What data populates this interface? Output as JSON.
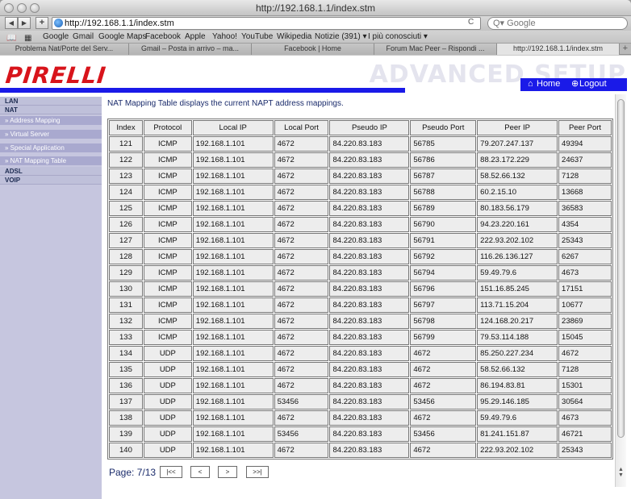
{
  "window": {
    "title": "http://192.168.1.1/index.stm"
  },
  "toolbar": {
    "back": "◀",
    "forward": "▶",
    "add": "+",
    "url": "http://192.168.1.1/index.stm",
    "reload": "C",
    "search_placeholder": "Q▾ Google"
  },
  "bookmarks": {
    "book_icon": "book-icon",
    "grid_icon": "grid-icon",
    "items": [
      "Google",
      "Gmail",
      "Google Maps",
      "Facebook",
      "Apple",
      "Yahoo!",
      "YouTube",
      "Wikipedia",
      "Notizie (391) ▾",
      "I più conosciuti ▾"
    ]
  },
  "tabs": [
    "Problema Nat/Porte del Serv...",
    "Gmail – Posta in arrivo – ma...",
    "Facebook | Home",
    "Forum Mac Peer – Rispondi ...",
    "http://192.168.1.1/index.stm"
  ],
  "tab_plus": "+",
  "header": {
    "logo": "PIRELLI",
    "advanced_setup": "ADVANCED SETUP",
    "home": "Home",
    "logout": "Logout"
  },
  "sidebar": {
    "lan": "LAN",
    "nat": "NAT",
    "address_mapping": "» Address Mapping",
    "virtual_server": "» Virtual Server",
    "special_application": "» Special Application",
    "nat_mapping_table": "» NAT Mapping Table",
    "adsl": "ADSL",
    "voip": "VOIP"
  },
  "main": {
    "description": "NAT Mapping Table displays the current NAPT address mappings.",
    "columns": [
      "Index",
      "Protocol",
      "Local IP",
      "Local Port",
      "Pseudo IP",
      "Pseudo Port",
      "Peer IP",
      "Peer Port"
    ],
    "rows": [
      [
        "121",
        "ICMP",
        "192.168.1.101",
        "4672",
        "84.220.83.183",
        "56785",
        "79.207.247.137",
        "49394"
      ],
      [
        "122",
        "ICMP",
        "192.168.1.101",
        "4672",
        "84.220.83.183",
        "56786",
        "88.23.172.229",
        "24637"
      ],
      [
        "123",
        "ICMP",
        "192.168.1.101",
        "4672",
        "84.220.83.183",
        "56787",
        "58.52.66.132",
        "7128"
      ],
      [
        "124",
        "ICMP",
        "192.168.1.101",
        "4672",
        "84.220.83.183",
        "56788",
        "60.2.15.10",
        "13668"
      ],
      [
        "125",
        "ICMP",
        "192.168.1.101",
        "4672",
        "84.220.83.183",
        "56789",
        "80.183.56.179",
        "36583"
      ],
      [
        "126",
        "ICMP",
        "192.168.1.101",
        "4672",
        "84.220.83.183",
        "56790",
        "94.23.220.161",
        "4354"
      ],
      [
        "127",
        "ICMP",
        "192.168.1.101",
        "4672",
        "84.220.83.183",
        "56791",
        "222.93.202.102",
        "25343"
      ],
      [
        "128",
        "ICMP",
        "192.168.1.101",
        "4672",
        "84.220.83.183",
        "56792",
        "116.26.136.127",
        "6267"
      ],
      [
        "129",
        "ICMP",
        "192.168.1.101",
        "4672",
        "84.220.83.183",
        "56794",
        "59.49.79.6",
        "4673"
      ],
      [
        "130",
        "ICMP",
        "192.168.1.101",
        "4672",
        "84.220.83.183",
        "56796",
        "151.16.85.245",
        "17151"
      ],
      [
        "131",
        "ICMP",
        "192.168.1.101",
        "4672",
        "84.220.83.183",
        "56797",
        "113.71.15.204",
        "10677"
      ],
      [
        "132",
        "ICMP",
        "192.168.1.101",
        "4672",
        "84.220.83.183",
        "56798",
        "124.168.20.217",
        "23869"
      ],
      [
        "133",
        "ICMP",
        "192.168.1.101",
        "4672",
        "84.220.83.183",
        "56799",
        "79.53.114.188",
        "15045"
      ],
      [
        "134",
        "UDP",
        "192.168.1.101",
        "4672",
        "84.220.83.183",
        "4672",
        "85.250.227.234",
        "4672"
      ],
      [
        "135",
        "UDP",
        "192.168.1.101",
        "4672",
        "84.220.83.183",
        "4672",
        "58.52.66.132",
        "7128"
      ],
      [
        "136",
        "UDP",
        "192.168.1.101",
        "4672",
        "84.220.83.183",
        "4672",
        "86.194.83.81",
        "15301"
      ],
      [
        "137",
        "UDP",
        "192.168.1.101",
        "53456",
        "84.220.83.183",
        "53456",
        "95.29.146.185",
        "30564"
      ],
      [
        "138",
        "UDP",
        "192.168.1.101",
        "4672",
        "84.220.83.183",
        "4672",
        "59.49.79.6",
        "4673"
      ],
      [
        "139",
        "UDP",
        "192.168.1.101",
        "53456",
        "84.220.83.183",
        "53456",
        "81.241.151.87",
        "46721"
      ],
      [
        "140",
        "UDP",
        "192.168.1.101",
        "4672",
        "84.220.83.183",
        "4672",
        "222.93.202.102",
        "25343"
      ]
    ],
    "pager": {
      "label": "Page: 7/13",
      "first": "|<<",
      "prev": "<",
      "next": ">",
      "last": ">>|"
    }
  },
  "colors": {
    "accent": "#1a1ae8",
    "logo": "#d8141b",
    "sidebar": "#c6c6df"
  }
}
